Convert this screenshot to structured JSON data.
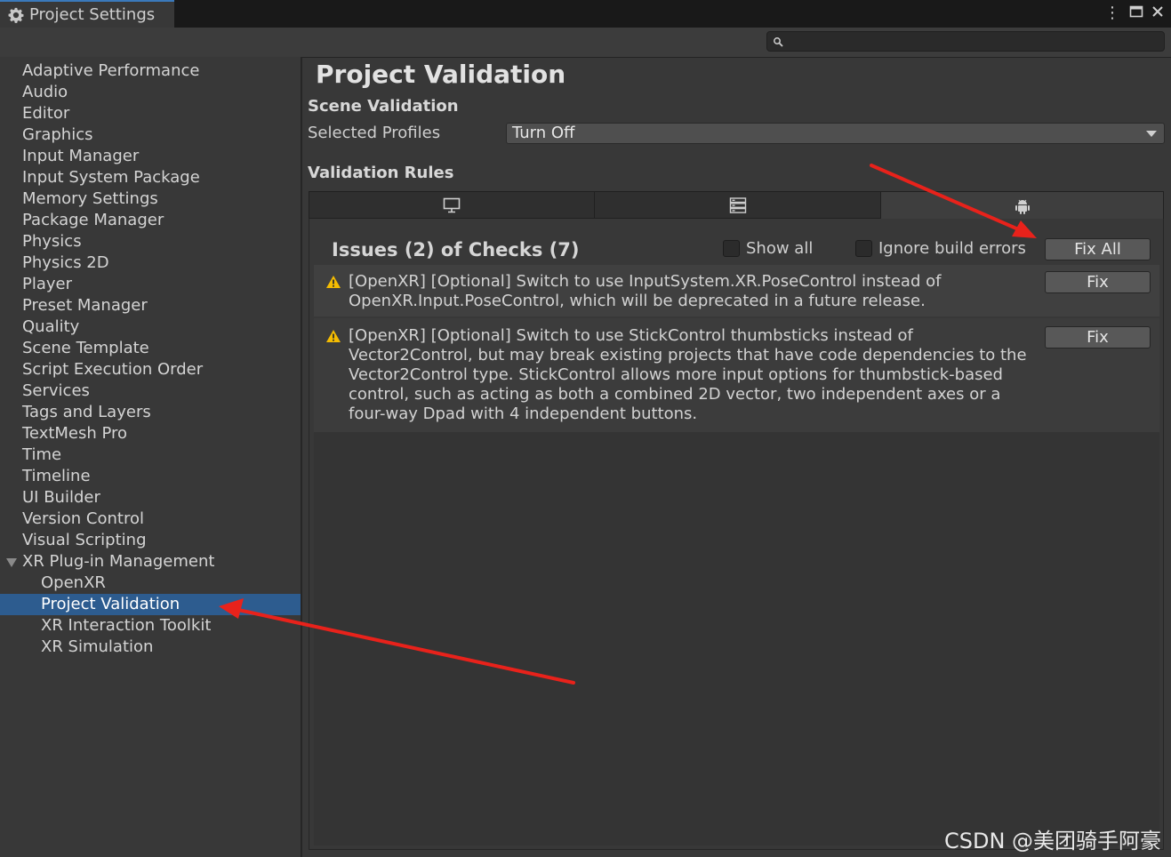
{
  "window": {
    "title": "Project Settings",
    "search_placeholder": ""
  },
  "sidebar": {
    "items": [
      {
        "label": "Adaptive Performance"
      },
      {
        "label": "Audio"
      },
      {
        "label": "Editor"
      },
      {
        "label": "Graphics"
      },
      {
        "label": "Input Manager"
      },
      {
        "label": "Input System Package"
      },
      {
        "label": "Memory Settings"
      },
      {
        "label": "Package Manager"
      },
      {
        "label": "Physics"
      },
      {
        "label": "Physics 2D"
      },
      {
        "label": "Player"
      },
      {
        "label": "Preset Manager"
      },
      {
        "label": "Quality"
      },
      {
        "label": "Scene Template"
      },
      {
        "label": "Script Execution Order"
      },
      {
        "label": "Services"
      },
      {
        "label": "Tags and Layers"
      },
      {
        "label": "TextMesh Pro"
      },
      {
        "label": "Time"
      },
      {
        "label": "Timeline"
      },
      {
        "label": "UI Builder"
      },
      {
        "label": "Version Control"
      },
      {
        "label": "Visual Scripting"
      },
      {
        "label": "XR Plug-in Management"
      }
    ],
    "sub_items": [
      {
        "label": "OpenXR"
      },
      {
        "label": "Project Validation"
      },
      {
        "label": "XR Interaction Toolkit"
      },
      {
        "label": "XR Simulation"
      }
    ],
    "selected": "Project Validation"
  },
  "main": {
    "title": "Project Validation",
    "scene_validation": {
      "heading": "Scene Validation",
      "profiles_label": "Selected Profiles",
      "profiles_value": "Turn Off"
    },
    "rules": {
      "heading": "Validation Rules",
      "tabs": [
        {
          "icon": "monitor-icon"
        },
        {
          "icon": "server-icon"
        },
        {
          "icon": "android-icon",
          "active": true
        }
      ],
      "summary": "Issues (2) of Checks (7)",
      "show_all_label": "Show all",
      "ignore_label": "Ignore build errors",
      "fix_all_label": "Fix All",
      "issues": [
        {
          "icon": "warning-icon",
          "lines": [
            "[OpenXR] [Optional] Switch to use InputSystem.XR.PoseControl instead of",
            "OpenXR.Input.PoseControl, which will be deprecated in a future release."
          ],
          "fix_label": "Fix"
        },
        {
          "icon": "warning-icon",
          "lines": [
            "[OpenXR] [Optional] Switch to use StickControl thumbsticks instead of",
            "Vector2Control, but may break existing projects that have code dependencies to the",
            "Vector2Control type. StickControl allows more input options for thumbstick-based",
            "control, such as acting as both a combined 2D vector, two independent axes or a",
            "four-way Dpad with 4 independent buttons."
          ],
          "fix_label": "Fix"
        }
      ]
    }
  },
  "watermark": "CSDN @美团骑手阿豪",
  "colors": {
    "accent": "#2d5c8f",
    "warning": "#f4bc02",
    "annotation_arrow": "#e8221b"
  }
}
